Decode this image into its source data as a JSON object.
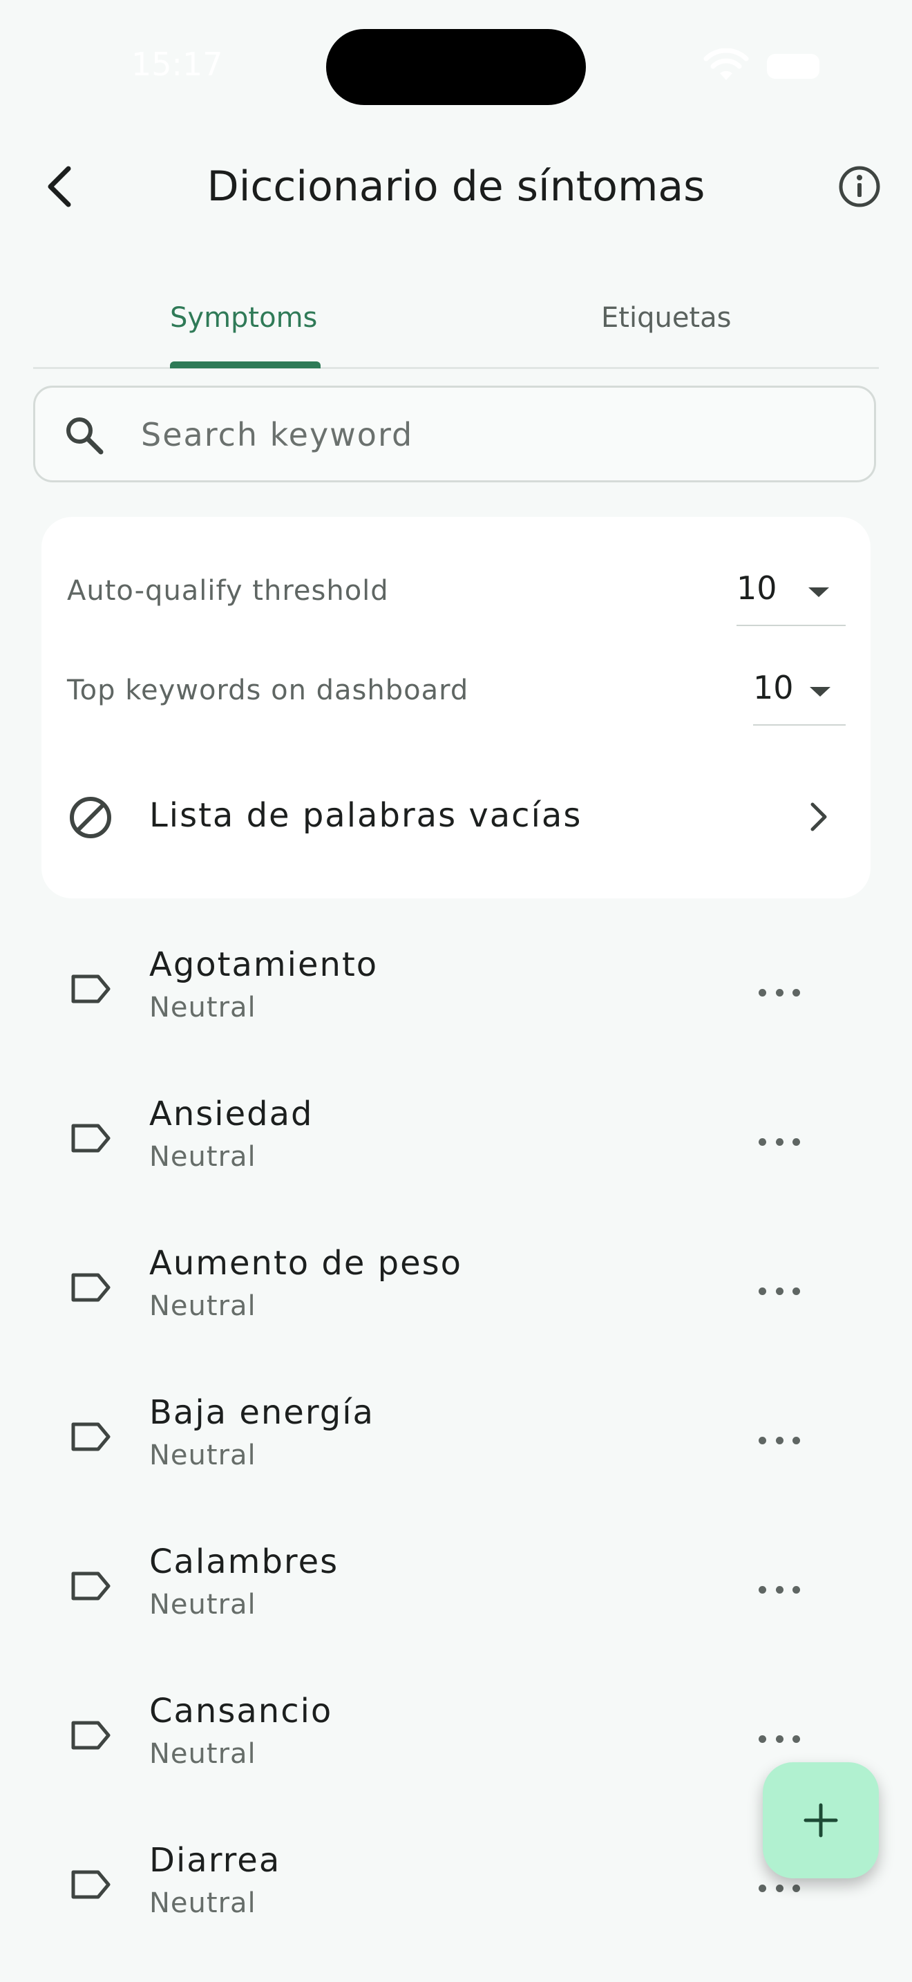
{
  "status_bar": {
    "time": "15:17"
  },
  "app_bar": {
    "title": "Diccionario de síntomas"
  },
  "tabs": [
    {
      "label": "Symptoms",
      "selected": true
    },
    {
      "label": "Etiquetas",
      "selected": false
    }
  ],
  "search": {
    "placeholder": "Search keyword",
    "value": ""
  },
  "settings": {
    "auto_qualify": {
      "label": "Auto-qualify threshold",
      "value": "10"
    },
    "top_keywords": {
      "label": "Top keywords on dashboard",
      "value": "10"
    },
    "stopwords": {
      "label": "Lista de palabras vacías"
    }
  },
  "symptoms": [
    {
      "name": "Agotamiento",
      "sentiment": "Neutral"
    },
    {
      "name": "Ansiedad",
      "sentiment": "Neutral"
    },
    {
      "name": "Aumento de peso",
      "sentiment": "Neutral"
    },
    {
      "name": "Baja energía",
      "sentiment": "Neutral"
    },
    {
      "name": "Calambres",
      "sentiment": "Neutral"
    },
    {
      "name": "Cansancio",
      "sentiment": "Neutral"
    },
    {
      "name": "Diarrea",
      "sentiment": "Neutral"
    }
  ],
  "colors": {
    "accent": "#2f7a57",
    "fab_background": "#b1f1d0",
    "background": "#f6f9f8"
  },
  "icons": {
    "back": "back-arrow-icon",
    "info": "info-icon",
    "search": "search-icon",
    "dropdown": "dropdown-arrow-icon",
    "stopwords": "block-icon",
    "chevron": "chevron-right-icon",
    "tag": "label-tag-icon",
    "more": "more-horizontal-icon",
    "add": "plus-icon"
  }
}
